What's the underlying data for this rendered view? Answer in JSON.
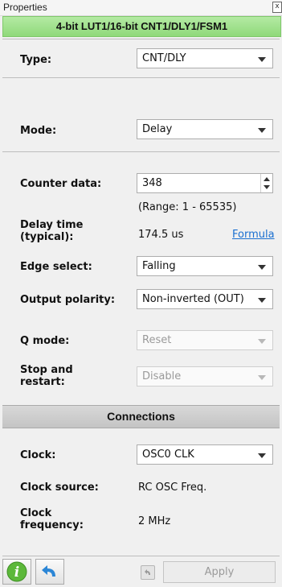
{
  "window": {
    "title": "Properties",
    "close_label": "x"
  },
  "header": {
    "title": "4-bit LUT1/16-bit CNT1/DLY1/FSM1"
  },
  "fields": {
    "type": {
      "label": "Type:",
      "value": "CNT/DLY"
    },
    "mode": {
      "label": "Mode:",
      "value": "Delay"
    },
    "counter_data": {
      "label": "Counter data:",
      "value": "348",
      "range": "(Range:  1 - 65535)"
    },
    "delay_time": {
      "label_line1": "Delay time",
      "label_line2": "(typical):",
      "value": "174.5 us",
      "link": "Formula"
    },
    "edge_select": {
      "label": "Edge select:",
      "value": "Falling"
    },
    "output_polarity": {
      "label": "Output polarity:",
      "value": "Non-inverted (OUT)"
    },
    "q_mode": {
      "label": "Q mode:",
      "value": "Reset",
      "disabled": true
    },
    "stop_restart": {
      "label_line1": "Stop and",
      "label_line2": "restart:",
      "value": "Disable",
      "disabled": true
    }
  },
  "connections": {
    "header": "Connections",
    "clock": {
      "label": "Clock:",
      "value": "OSC0 CLK"
    },
    "clock_source": {
      "label": "Clock source:",
      "value": "RC OSC Freq."
    },
    "clock_frequency": {
      "label_line1": "Clock",
      "label_line2": "frequency:",
      "value": "2 MHz"
    }
  },
  "footer": {
    "info_icon": "info-icon",
    "undo_icon": "undo-icon",
    "apply_label": "Apply",
    "apply_disabled": true,
    "colors": {
      "info_green": "#5cb83a",
      "undo_blue": "#2b86d6"
    }
  }
}
